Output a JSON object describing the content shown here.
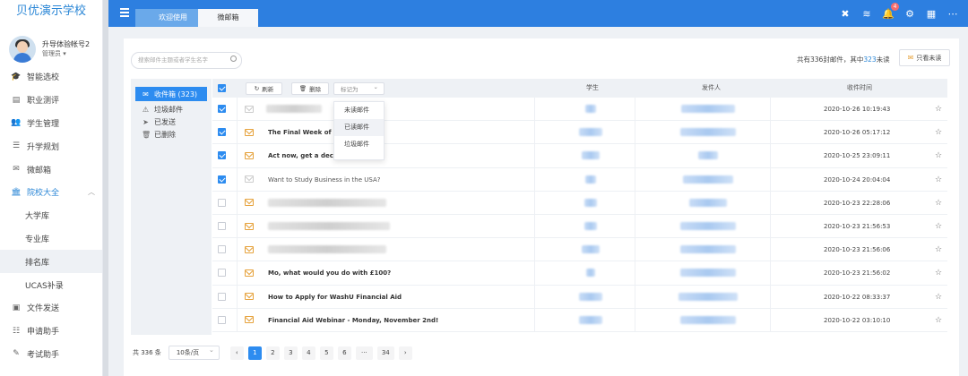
{
  "app": {
    "title": "贝优演示学校"
  },
  "user": {
    "name": "升导体验帐号2",
    "role": "管理员 ▾"
  },
  "sidebar": {
    "items": [
      {
        "icon": "graduation-cap-icon",
        "glyph": "🎓",
        "label": "智能选校"
      },
      {
        "icon": "assessment-icon",
        "glyph": "▤",
        "label": "职业测评"
      },
      {
        "icon": "students-icon",
        "glyph": "👥",
        "label": "学生管理"
      },
      {
        "icon": "planning-icon",
        "glyph": "☰",
        "label": "升学规划"
      },
      {
        "icon": "mail-icon",
        "glyph": "✉",
        "label": "微邮箱"
      },
      {
        "icon": "bank-icon",
        "glyph": "🏛",
        "label": "院校大全"
      }
    ],
    "sub_items": [
      {
        "label": "大学库"
      },
      {
        "label": "专业库"
      },
      {
        "label": "排名库"
      },
      {
        "label": "UCAS补录"
      }
    ],
    "bottom_items": [
      {
        "icon": "file-send-icon",
        "glyph": "▣",
        "label": "文件发送"
      },
      {
        "icon": "apply-icon",
        "glyph": "☷",
        "label": "申请助手"
      },
      {
        "icon": "exam-icon",
        "glyph": "✎",
        "label": "考试助手"
      }
    ]
  },
  "tabs": [
    {
      "label": "欢迎使用"
    },
    {
      "label": "微邮箱"
    }
  ],
  "header": {
    "notification_count": "4"
  },
  "mail": {
    "search_placeholder": "搜索邮件主题或者学生名字",
    "count": {
      "prefix": "共有",
      "total": "336",
      "mid": "封邮件，其中",
      "unread": "323",
      "suffix": "未读"
    },
    "unread_only_label": "只看未读",
    "folders": [
      {
        "icon": "inbox-icon",
        "glyph": "✉",
        "label": "收件箱 (323)"
      },
      {
        "icon": "spam-icon",
        "glyph": "⚠",
        "label": "垃圾邮件"
      },
      {
        "icon": "sent-icon",
        "glyph": "➤",
        "label": "已发送"
      },
      {
        "icon": "trash-icon",
        "glyph": "🗑",
        "label": "已删除"
      }
    ],
    "toolbar": {
      "refresh": "刷新",
      "delete": "删除",
      "mark_as": "标记为"
    },
    "columns": {
      "student": "学生",
      "sender": "发件人",
      "received": "收件时间"
    },
    "mark_options": [
      {
        "label": "未读邮件"
      },
      {
        "label": "已读邮件"
      },
      {
        "label": "垃圾邮件"
      }
    ],
    "rows": [
      {
        "subject": "",
        "date": "2020-10-26 10:19:43",
        "checked": true
      },
      {
        "subject": "The Final Week of Cla",
        "date": "2020-10-26 05:17:12",
        "checked": true
      },
      {
        "subject": "Act now, get a decisio",
        "date": "2020-10-25 23:09:11",
        "checked": true
      },
      {
        "subject": "Want to Study Business in the USA?",
        "date": "2020-10-24 20:04:04",
        "checked": true
      },
      {
        "subject": "",
        "date": "2020-10-23 22:28:06",
        "checked": false
      },
      {
        "subject": "",
        "date": "2020-10-23 21:56:53",
        "checked": false
      },
      {
        "subject": "",
        "date": "2020-10-23 21:56:06",
        "checked": false
      },
      {
        "subject": "Mo, what would you do with £100?",
        "date": "2020-10-23 21:56:02",
        "checked": false
      },
      {
        "subject": "How to Apply for WashU Financial Aid",
        "date": "2020-10-22 08:33:37",
        "checked": false
      },
      {
        "subject": "Financial Aid Webinar - Monday, November 2nd!",
        "date": "2020-10-22 03:10:10",
        "checked": false
      }
    ],
    "pagination": {
      "total": "共 336 条",
      "page_size": "10条/页",
      "prev": "‹",
      "next": "›",
      "pages": [
        "1",
        "2",
        "3",
        "4",
        "5",
        "6",
        "···",
        "34"
      ],
      "current": "1"
    }
  }
}
